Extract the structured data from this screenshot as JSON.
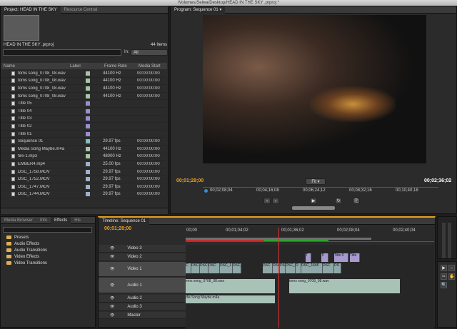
{
  "window": {
    "title": "/Volumes/Selwa/Desktop/HEAD IN THE SKY .prproj *"
  },
  "project": {
    "tabs": [
      "Project: HEAD IN THE SKY",
      "Resource Central"
    ],
    "name": "HEAD IN THE SKY .prproj",
    "count": "44 Items",
    "in_label": "In:",
    "in_value": "All",
    "columns": [
      "Name",
      "Label",
      "Frame Rate",
      "Media Start"
    ],
    "items": [
      {
        "name": "toms song_0708_08.wav",
        "label_color": "#a8c4a8",
        "rate": "44100 Hz",
        "start": "00:00:00:00"
      },
      {
        "name": "toms song_0708_08.wav",
        "label_color": "#a8c4a8",
        "rate": "44100 Hz",
        "start": "00:00:00:00"
      },
      {
        "name": "toms song_0708_08.wav",
        "label_color": "#a8c4a8",
        "rate": "44100 Hz",
        "start": "00:00:00:00"
      },
      {
        "name": "toms song_0708_08.wav",
        "label_color": "#a8c4a8",
        "rate": "44100 Hz",
        "start": "00:00:00:00"
      },
      {
        "name": "Title 05",
        "label_color": "#9a8ed0",
        "rate": "",
        "start": ""
      },
      {
        "name": "Title 04",
        "label_color": "#9a8ed0",
        "rate": "",
        "start": ""
      },
      {
        "name": "Title 03",
        "label_color": "#9a8ed0",
        "rate": "",
        "start": ""
      },
      {
        "name": "Title 02",
        "label_color": "#9a8ed0",
        "rate": "",
        "start": ""
      },
      {
        "name": "Title 01",
        "label_color": "#9a8ed0",
        "rate": "",
        "start": ""
      },
      {
        "name": "Sequence 01",
        "label_color": "#7fc0b8",
        "rate": "29.97 fps",
        "start": "00:00:00:00"
      },
      {
        "name": "Media Song Maybe.m4a",
        "label_color": "#a8c4a8",
        "rate": "44100 Hz",
        "start": "00:00:00:00"
      },
      {
        "name": "fire-1.mp3",
        "label_color": "#a8c4a8",
        "rate": "48000 Hz",
        "start": "00:00:00:00"
      },
      {
        "name": "EMBER4.mp4",
        "label_color": "#a0b0c8",
        "rate": "25.00 fps",
        "start": "00:00:00:00"
      },
      {
        "name": "DSC_1758.MOV",
        "label_color": "#a0b0c8",
        "rate": "29.97 fps",
        "start": "00:00:00:00"
      },
      {
        "name": "DSC_1752.MOV",
        "label_color": "#a0b0c8",
        "rate": "29.97 fps",
        "start": "00:00:00:00"
      },
      {
        "name": "DSC_1747.MOV",
        "label_color": "#a0b0c8",
        "rate": "29.97 fps",
        "start": "00:00:00:00"
      },
      {
        "name": "DSC_1744.MOV",
        "label_color": "#a0b0c8",
        "rate": "29.97 fps",
        "start": "00:00:00:00"
      }
    ]
  },
  "program": {
    "tab": "Program: Sequence 01",
    "current_time": "00;01;28;00",
    "fit": "Fit",
    "duration": "00;02;36;02",
    "ruler": [
      "00;00",
      "00;02;08;04",
      "00;04;16;08",
      "00;06;24;12",
      "00;08;32;16",
      "00;10;40;18"
    ]
  },
  "effects": {
    "tabs": [
      "Media Browser",
      "Info",
      "Effects",
      "His"
    ],
    "folders": [
      "Presets",
      "Audio Effects",
      "Audio Transitions",
      "Video Effects",
      "Video Transitions"
    ]
  },
  "timeline": {
    "tab": "Timeline: Sequence 01",
    "timecode": "00;01;28;00",
    "ruler": [
      "00;00",
      "00;01;04;02",
      "00;01;36;02",
      "00;02;08;04",
      "00;02;40;04"
    ],
    "tracks": [
      "Video 3",
      "Video 2",
      "Video 1",
      "Audio 1",
      "Audio 2",
      "Audio 3",
      "Master"
    ],
    "video_clips": [
      "C",
      "DSC",
      "DSC",
      "DSC",
      "DSC_1",
      "DSC_",
      "DSC",
      "DSC",
      "DS",
      "DSC_1",
      "D",
      "DSC_1646",
      "DSC",
      "DS"
    ],
    "title_clips": [
      "T",
      "Ti",
      "Title 0",
      "Title"
    ],
    "audio1_clips": [
      "ems song_0708_08.wav",
      "toms song_0708_08.wav"
    ],
    "audio2_clip": "dia Song Maybe.m4a"
  },
  "tools": [
    "▶",
    "⇔",
    "✂",
    "✋",
    "🔍"
  ]
}
